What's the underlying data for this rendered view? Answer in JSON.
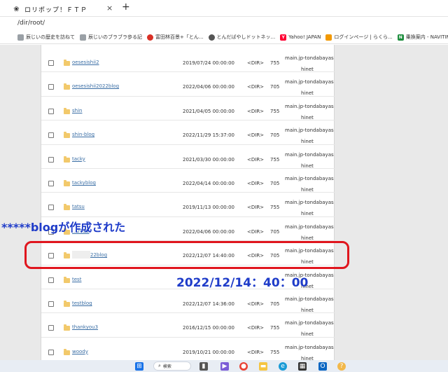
{
  "browser": {
    "tab_title": "ロリポップ！ＦＴＰ",
    "tab_close": "×",
    "new_tab": "+",
    "url": "/dir/root/"
  },
  "bookmarks": [
    {
      "label": "辰じいの歴史を訪ねて",
      "icon": "page-icon",
      "color": "#9aa0a6"
    },
    {
      "label": "辰じいのブラブラ歩る記",
      "icon": "page-icon",
      "color": "#9aa0a6"
    },
    {
      "label": "富田林百景+「とん...",
      "icon": "page-icon",
      "color": "#d93025"
    },
    {
      "label": "とんだばやしドットネッ...",
      "icon": "globe-icon",
      "color": "#555555"
    },
    {
      "label": "Yahoo! JAPAN",
      "icon": "yahoo-icon",
      "color": "#ff0033"
    },
    {
      "label": "ログインページ | らくら...",
      "icon": "page-icon",
      "color": "#f29900"
    },
    {
      "label": "乗換案内 - NAVITIME",
      "icon": "navitime-icon",
      "color": "#1e8e3e"
    }
  ],
  "files": [
    {
      "name": "oesesishii2",
      "date": "2019/07/24 00:00:00",
      "type": "<DIR>",
      "perm": "755",
      "owner": "main.jp-tondabayas",
      "owner2": "hinet"
    },
    {
      "name": "oesesishii2022blog",
      "date": "2022/04/06 00:00:00",
      "type": "<DIR>",
      "perm": "705",
      "owner": "main.jp-tondabayas",
      "owner2": "hinet"
    },
    {
      "name": "shin",
      "date": "2021/04/05 00:00:00",
      "type": "<DIR>",
      "perm": "755",
      "owner": "main.jp-tondabayas",
      "owner2": "hinet"
    },
    {
      "name": "shin-blog",
      "date": "2022/11/29 15:37:00",
      "type": "<DIR>",
      "perm": "705",
      "owner": "main.jp-tondabayas",
      "owner2": "hinet"
    },
    {
      "name": "tacky",
      "date": "2021/03/30 00:00:00",
      "type": "<DIR>",
      "perm": "755",
      "owner": "main.jp-tondabayas",
      "owner2": "hinet"
    },
    {
      "name": "tackyblog",
      "date": "2022/04/14 00:00:00",
      "type": "<DIR>",
      "perm": "705",
      "owner": "main.jp-tondabayas",
      "owner2": "hinet"
    },
    {
      "name": "tatsu",
      "date": "2019/11/13 00:00:00",
      "type": "<DIR>",
      "perm": "755",
      "owner": "main.jp-tondabayas",
      "owner2": "hinet"
    },
    {
      "name": "...2022",
      "date": "2022/04/06 00:00:00",
      "type": "<DIR>",
      "perm": "705",
      "owner": "main.jp-tondabayas",
      "owner2": "hinet"
    },
    {
      "name": "22blog",
      "date": "2022/12/07 14:40:00",
      "type": "<DIR>",
      "perm": "705",
      "owner": "main.jp-tondabayas",
      "owner2": "hinet"
    },
    {
      "name": "test",
      "date": "",
      "type": "",
      "perm": "",
      "owner": "main.jp-tondabayas",
      "owner2": "hinet"
    },
    {
      "name": "testblog",
      "date": "2022/12/07 14:36:00",
      "type": "<DIR>",
      "perm": "705",
      "owner": "main.jp-tondabayas",
      "owner2": "hinet"
    },
    {
      "name": "thankyou3",
      "date": "2016/12/15 00:00:00",
      "type": "<DIR>",
      "perm": "755",
      "owner": "main.jp-tondabayas",
      "owner2": "hinet"
    },
    {
      "name": "woody",
      "date": "2019/10/21 00:00:00",
      "type": "<DIR>",
      "perm": "755",
      "owner": "main.jp-tondabayas",
      "owner2": "hinet"
    }
  ],
  "annotations": {
    "created_note": "*****blogが作成された",
    "date_note": "2022/12/14：40：00",
    "highlight_color": "#e0161e",
    "note_color": "#1f3cc9"
  },
  "taskbar": {
    "search_label": "検索",
    "search_icon": "magnifier-icon",
    "icons": [
      "windows-start-icon",
      "task-view-icon",
      "meet-icon",
      "chrome-icon",
      "file-explorer-icon",
      "edge-icon",
      "store-icon",
      "outlook-icon",
      "help-icon"
    ]
  }
}
